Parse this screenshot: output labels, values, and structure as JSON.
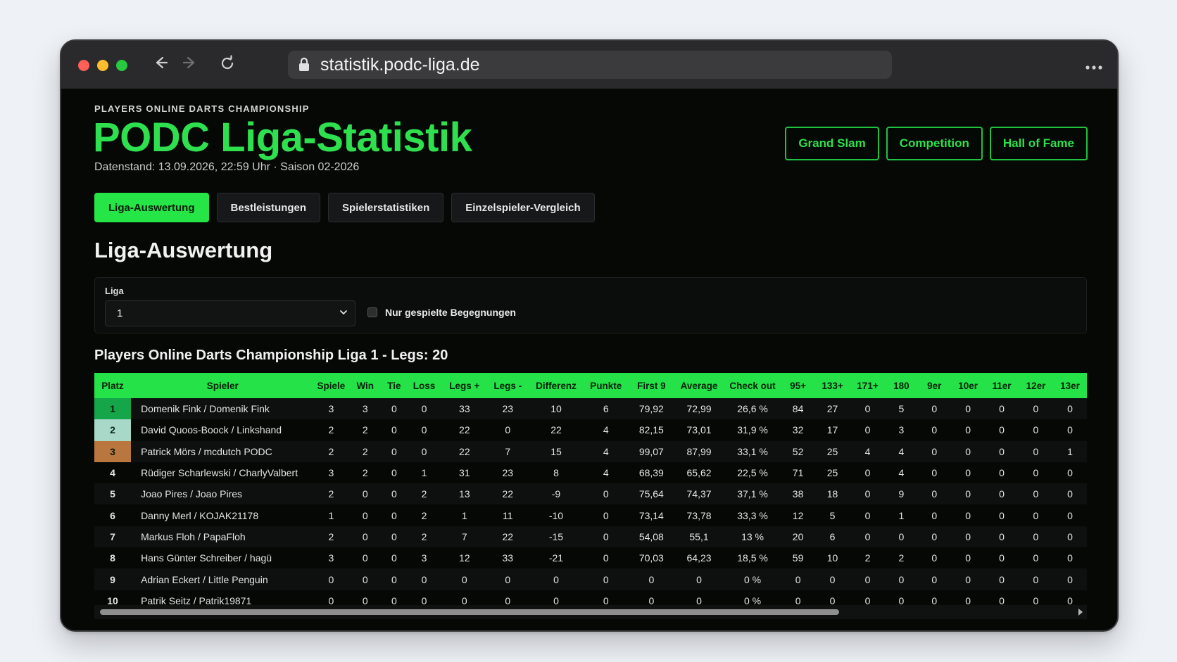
{
  "browser": {
    "url": "statistik.podc-liga.de",
    "back_icon": "arrow-left-icon",
    "forward_icon": "arrow-right-icon",
    "reload_icon": "reload-icon",
    "menu_icon": "more-dots-icon"
  },
  "header": {
    "kicker": "PLAYERS ONLINE DARTS CHAMPIONSHIP",
    "title": "PODC Liga-Statistik",
    "subtitle": "Datenstand: 13.09.2026, 22:59 Uhr · Saison 02-2026",
    "links": [
      "Grand Slam",
      "Competition",
      "Hall of Fame"
    ]
  },
  "tabs": [
    {
      "label": "Liga-Auswertung",
      "active": true
    },
    {
      "label": "Bestleistungen",
      "active": false
    },
    {
      "label": "Spielerstatistiken",
      "active": false
    },
    {
      "label": "Einzelspieler-Vergleich",
      "active": false
    }
  ],
  "section_title": "Liga-Auswertung",
  "filter": {
    "label": "Liga",
    "selected": "1",
    "checkbox_label": "Nur gespielte Begegnungen",
    "checkbox_checked": false
  },
  "table": {
    "title": "Players Online Darts Championship Liga 1 - Legs: 20",
    "columns": [
      "Platz",
      "Spieler",
      "Spiele",
      "Win",
      "Tie",
      "Loss",
      "Legs +",
      "Legs -",
      "Differenz",
      "Punkte",
      "First 9",
      "Average",
      "Check out",
      "95+",
      "133+",
      "171+",
      "180",
      "9er",
      "10er",
      "11er",
      "12er",
      "13er"
    ],
    "rows": [
      [
        "1",
        "Domenik Fink / Domenik Fink",
        "3",
        "3",
        "0",
        "0",
        "33",
        "23",
        "10",
        "6",
        "79,92",
        "72,99",
        "26,6 %",
        "84",
        "27",
        "0",
        "5",
        "0",
        "0",
        "0",
        "0",
        "0"
      ],
      [
        "2",
        "David Quoos-Boock / Linkshand",
        "2",
        "2",
        "0",
        "0",
        "22",
        "0",
        "22",
        "4",
        "82,15",
        "73,01",
        "31,9 %",
        "32",
        "17",
        "0",
        "3",
        "0",
        "0",
        "0",
        "0",
        "0"
      ],
      [
        "3",
        "Patrick Mörs / mcdutch PODC",
        "2",
        "2",
        "0",
        "0",
        "22",
        "7",
        "15",
        "4",
        "99,07",
        "87,99",
        "33,1 %",
        "52",
        "25",
        "4",
        "4",
        "0",
        "0",
        "0",
        "0",
        "1"
      ],
      [
        "4",
        "Rüdiger Scharlewski / CharlyValbert",
        "3",
        "2",
        "0",
        "1",
        "31",
        "23",
        "8",
        "4",
        "68,39",
        "65,62",
        "22,5 %",
        "71",
        "25",
        "0",
        "4",
        "0",
        "0",
        "0",
        "0",
        "0"
      ],
      [
        "5",
        "Joao Pires / Joao Pires",
        "2",
        "0",
        "0",
        "2",
        "13",
        "22",
        "-9",
        "0",
        "75,64",
        "74,37",
        "37,1 %",
        "38",
        "18",
        "0",
        "9",
        "0",
        "0",
        "0",
        "0",
        "0"
      ],
      [
        "6",
        "Danny Merl / KOJAK21178",
        "1",
        "0",
        "0",
        "2",
        "1",
        "11",
        "-10",
        "0",
        "73,14",
        "73,78",
        "33,3 %",
        "12",
        "5",
        "0",
        "1",
        "0",
        "0",
        "0",
        "0",
        "0"
      ],
      [
        "7",
        "Markus Floh / PapaFloh",
        "2",
        "0",
        "0",
        "2",
        "7",
        "22",
        "-15",
        "0",
        "54,08",
        "55,1",
        "13 %",
        "20",
        "6",
        "0",
        "0",
        "0",
        "0",
        "0",
        "0",
        "0"
      ],
      [
        "8",
        "Hans Günter Schreiber / hagü",
        "3",
        "0",
        "0",
        "3",
        "12",
        "33",
        "-21",
        "0",
        "70,03",
        "64,23",
        "18,5 %",
        "59",
        "10",
        "2",
        "2",
        "0",
        "0",
        "0",
        "0",
        "0"
      ],
      [
        "9",
        "Adrian Eckert / Little Penguin",
        "0",
        "0",
        "0",
        "0",
        "0",
        "0",
        "0",
        "0",
        "0",
        "0",
        "0 %",
        "0",
        "0",
        "0",
        "0",
        "0",
        "0",
        "0",
        "0",
        "0"
      ],
      [
        "10",
        "Patrik Seitz / Patrik19871",
        "0",
        "0",
        "0",
        "0",
        "0",
        "0",
        "0",
        "0",
        "0",
        "0",
        "0 %",
        "0",
        "0",
        "0",
        "0",
        "0",
        "0",
        "0",
        "0",
        "0"
      ]
    ],
    "rank_colors": {
      "1": "#15a64a",
      "2": "#a8d8c8",
      "3": "#b9773f"
    }
  },
  "colors": {
    "accent": "#25e547",
    "background": "#060806"
  }
}
